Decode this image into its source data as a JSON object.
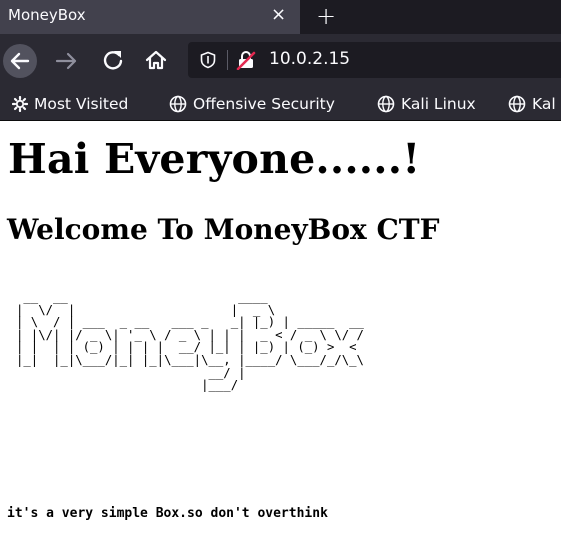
{
  "browser": {
    "tab": {
      "title": "MoneyBox",
      "close_glyph": "×"
    },
    "new_tab_glyph": "+",
    "url": "10.0.2.15",
    "icons": {
      "back": "back-arrow-icon",
      "forward": "forward-arrow-icon",
      "reload": "reload-icon",
      "home": "home-icon",
      "shield": "tracking-protection-shield-icon",
      "insecure": "insecure-lock-icon",
      "bookmark_gear": "gear-icon",
      "bookmark_globe": "globe-icon"
    },
    "bookmarks": [
      {
        "label": "Most Visited"
      },
      {
        "label": "Offensive Security"
      },
      {
        "label": "Kali Linux"
      },
      {
        "label": "Kal"
      }
    ],
    "colors": {
      "tabbar": "#1c1b22",
      "toolbar": "#2b2a33",
      "insecure_icon": "#e22850"
    }
  },
  "page": {
    "heading": "Hai Everyone......!",
    "subheading": "Welcome To MoneyBox CTF",
    "ascii_art": " __  __                       ____\n|  \\/  |                     |  _ \\\n| \\  / | ___  _ __   ___ _   _| |_) | _____  __\n| |\\/| |/ _ \\| '_ \\ / _ \\ | | |  _ < / _ \\ \\/ /\n| |  | | (_) | | | |  __/ |_| | |_) | (_) >  <\n|_|  |_|\\___/|_| |_|\\___|\\__, |____/ \\___/_/\\_\\\n                          __/ |\n                         |___/",
    "note": "it's a very simple Box.so don't overthink"
  }
}
